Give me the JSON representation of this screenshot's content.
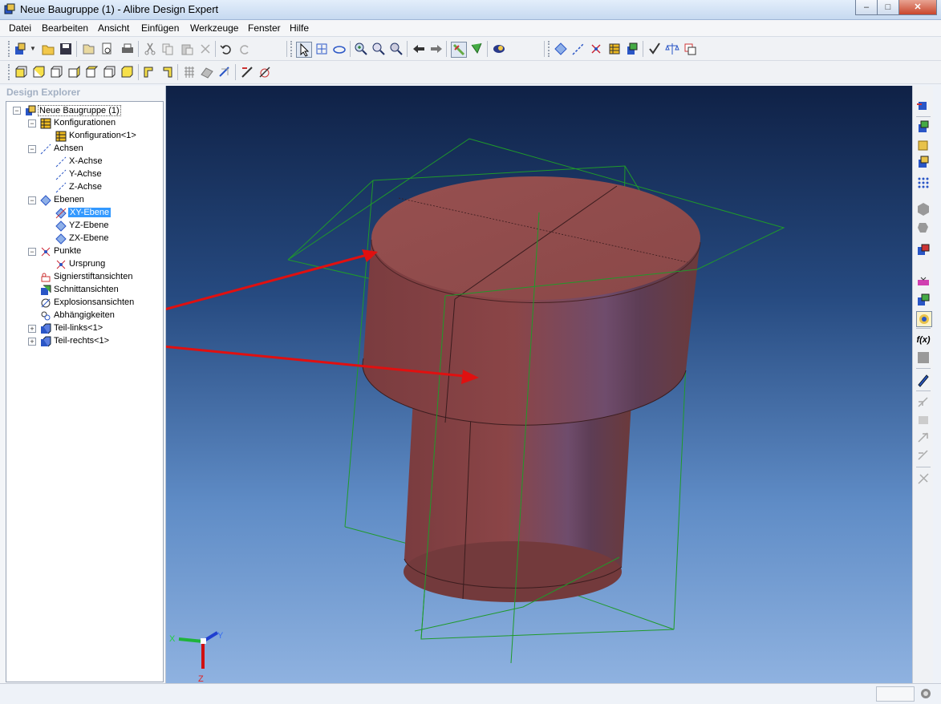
{
  "window": {
    "title": "Neue Baugruppe (1) - Alibre Design Expert",
    "minimize": "–",
    "maximize": "□",
    "close": "✕"
  },
  "menu": [
    "Datei",
    "Bearbeiten",
    "Ansicht",
    "Einfügen",
    "Werkzeuge",
    "Fenster",
    "Hilfe"
  ],
  "toolbar1": {
    "icons": [
      "new-assembly-icon",
      "open-folder-icon",
      "save-icon",
      "open-file-icon",
      "print-preview-icon",
      "print-icon",
      "cut-icon",
      "copy-icon",
      "paste-icon",
      "delete-icon",
      "undo-icon",
      "redo-icon",
      "select-arrow-icon",
      "pan-icon",
      "rotate-icon",
      "zoom-in-icon",
      "zoom-window-icon",
      "zoom-icon",
      "back-icon",
      "forward-icon",
      "measure-icon",
      "constraint-icon",
      "render-icon",
      "plane-icon",
      "axis-icon",
      "point-icon",
      "table-icon",
      "part-icon",
      "check-icon",
      "balance-icon",
      "layer-icon"
    ]
  },
  "toolbar2": {
    "icons": [
      "view-front-icon",
      "view-back-icon",
      "view-left-icon",
      "view-right-icon",
      "view-top-icon",
      "view-bottom-icon",
      "view-iso-icon",
      "view-normal-icon",
      "view-flip-icon",
      "section-grid-icon",
      "section-icon",
      "explode-icon",
      "sketch-icon",
      "measure-tool-icon"
    ]
  },
  "explorer": {
    "title": "Design Explorer",
    "tree": [
      {
        "label": "Neue Baugruppe (1)",
        "icon": "assembly-icon",
        "expander": "−"
      },
      {
        "label": "Konfigurationen",
        "icon": "configurations-icon",
        "expander": "−"
      },
      {
        "label": "Konfiguration<1>",
        "icon": "configuration-icon",
        "expander": ""
      },
      {
        "label": "Achsen",
        "icon": "axes-icon",
        "expander": "−"
      },
      {
        "label": "X-Achse",
        "icon": "axis-line-icon",
        "expander": ""
      },
      {
        "label": "Y-Achse",
        "icon": "axis-line-icon",
        "expander": ""
      },
      {
        "label": "Z-Achse",
        "icon": "axis-line-icon",
        "expander": ""
      },
      {
        "label": "Ebenen",
        "icon": "planes-icon",
        "expander": "−"
      },
      {
        "label": "XY-Ebene",
        "icon": "plane-item-icon",
        "expander": ""
      },
      {
        "label": "YZ-Ebene",
        "icon": "plane-item-icon",
        "expander": ""
      },
      {
        "label": "ZX-Ebene",
        "icon": "plane-item-icon",
        "expander": ""
      },
      {
        "label": "Punkte",
        "icon": "points-icon",
        "expander": "−"
      },
      {
        "label": "Ursprung",
        "icon": "origin-icon",
        "expander": ""
      },
      {
        "label": "Signierstiftansichten",
        "icon": "marker-views-icon",
        "expander": ""
      },
      {
        "label": "Schnittansichten",
        "icon": "section-views-icon",
        "expander": ""
      },
      {
        "label": "Explosionsansichten",
        "icon": "exploded-views-icon",
        "expander": ""
      },
      {
        "label": "Abhängigkeiten",
        "icon": "constraints-icon",
        "expander": ""
      },
      {
        "label": "Teil-links<1>",
        "icon": "part-icon",
        "expander": "+"
      },
      {
        "label": "Teil-rechts<1>",
        "icon": "part-icon",
        "expander": "+"
      }
    ],
    "selected": "XY-Ebene"
  },
  "viewport": {
    "triad": {
      "x": "X",
      "y": "Y",
      "z": "Z"
    },
    "colors": {
      "part": "#8a4848",
      "wire": "#1f8a2a",
      "arrow": "#e01010"
    }
  },
  "right_toolbar": {
    "icons": [
      "insert-part-icon",
      "part-a-icon",
      "part-b-icon",
      "part-c-icon",
      "pattern-icon",
      "hexagon-icon",
      "shape-icon",
      "replace-icon",
      "constraint-a-icon",
      "constraint-b-icon",
      "constraint-c-icon",
      "formula-icon",
      "gray-box-icon",
      "pen-icon",
      "disabled-a-icon",
      "disabled-b-icon",
      "disabled-c-icon",
      "disabled-d-icon",
      "disabled-e-icon"
    ]
  },
  "status": {
    "text": ""
  }
}
